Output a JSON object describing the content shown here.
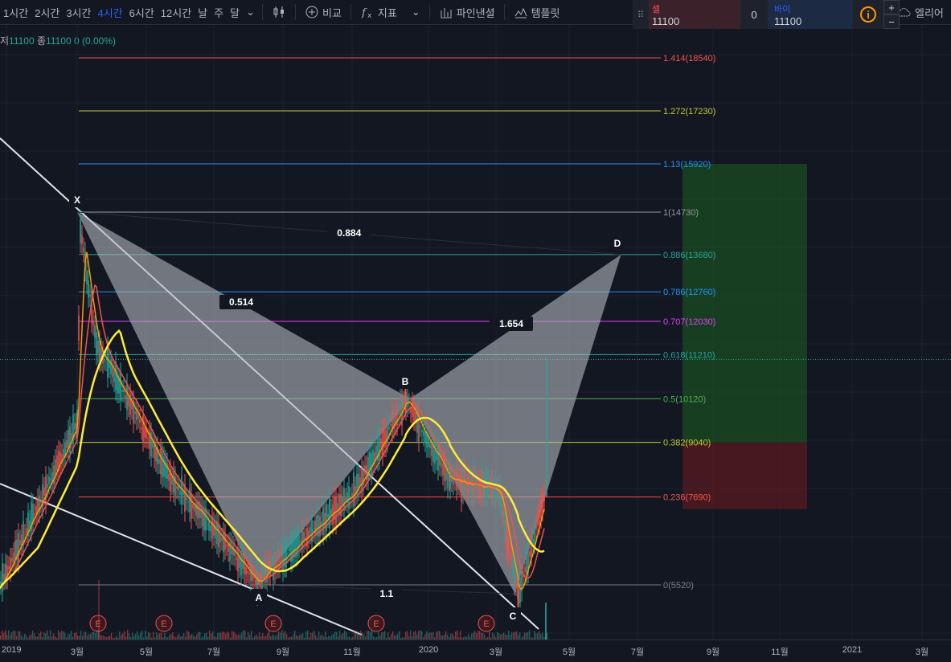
{
  "toolbar": {
    "intervals": [
      "1시간",
      "2시간",
      "3시간",
      "4시간",
      "6시간",
      "12시간",
      "날",
      "주",
      "달"
    ],
    "active_interval": "4시간",
    "compare_label": "비교",
    "indicators_label": "지표",
    "pine_label": "파인낸셜",
    "template_label": "템플릿",
    "alert_label": "엘리어"
  },
  "trade": {
    "sell_label": "셀",
    "sell_price": "11100",
    "qty": "0",
    "buy_label": "바이",
    "buy_price": "11100",
    "plus": "+",
    "minus": "−"
  },
  "legend": {
    "low_label": "저",
    "low_value": "11100",
    "close_label": "종",
    "close_value": "11100",
    "change": "0 (0.00%)"
  },
  "colors": {
    "background": "#131722",
    "up": "#26a69a",
    "down": "#ef5350",
    "pattern_fill": "#b2b5be",
    "target_zone": "#1b5e20",
    "stop_zone": "#5d1a20"
  },
  "chart_data": {
    "type": "line",
    "title": "",
    "price_range": [
      4000,
      19500
    ],
    "time_range": [
      "2018-12",
      "2021-04"
    ],
    "fib_levels": [
      {
        "label": "1.414(18540)",
        "ratio": 1.414,
        "price": 18540,
        "color": "#ef5350"
      },
      {
        "label": "1.272(17230)",
        "ratio": 1.272,
        "price": 17230,
        "color": "#c0ca33"
      },
      {
        "label": "1.13(15920)",
        "ratio": 1.13,
        "price": 15920,
        "color": "#2196f3"
      },
      {
        "label": "1(14730)",
        "ratio": 1,
        "price": 14730,
        "color": "#9598a1"
      },
      {
        "label": "0.886(13680)",
        "ratio": 0.886,
        "price": 13680,
        "color": "#26a69a"
      },
      {
        "label": "0.786(12760)",
        "ratio": 0.786,
        "price": 12760,
        "color": "#2196f3"
      },
      {
        "label": "0.707(12030)",
        "ratio": 0.707,
        "price": 12030,
        "color": "#e040fb"
      },
      {
        "label": "0.618(11210)",
        "ratio": 0.618,
        "price": 11210,
        "color": "#26a69a"
      },
      {
        "label": "0.5(10120)",
        "ratio": 0.5,
        "price": 10120,
        "color": "#4caf50"
      },
      {
        "label": "0.382(9040)",
        "ratio": 0.382,
        "price": 9040,
        "color": "#c0ca33"
      },
      {
        "label": "0.236(7690)",
        "ratio": 0.236,
        "price": 7690,
        "color": "#ef5350"
      },
      {
        "label": "0(5520)",
        "ratio": 0,
        "price": 5520,
        "color": "#787b86"
      }
    ],
    "pattern_points": [
      {
        "label": "X",
        "date": "2019-03-01",
        "price": 14730
      },
      {
        "label": "A",
        "date": "2019-08-05",
        "price": 5520
      },
      {
        "label": "B",
        "date": "2019-12-15",
        "price": 10120
      },
      {
        "label": "C",
        "date": "2020-03-15",
        "price": 5300
      },
      {
        "label": "D",
        "date": "2020-06-15",
        "price": 13680
      }
    ],
    "pattern_ratios": [
      "0.884",
      "0.514",
      "1.654",
      "1.1"
    ],
    "x_ticks": [
      "2019",
      "3월",
      "5월",
      "7월",
      "9월",
      "11월",
      "2020",
      "3월",
      "5월",
      "7월",
      "9월",
      "11월",
      "2021",
      "3월"
    ],
    "earnings_marker": "E"
  }
}
